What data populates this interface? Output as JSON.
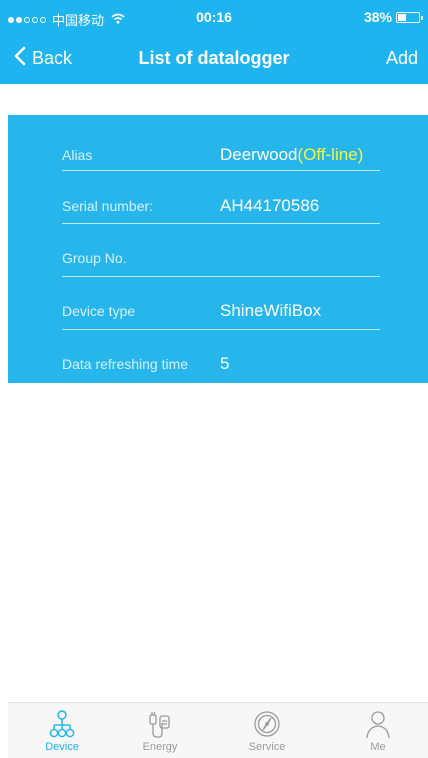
{
  "status_bar": {
    "carrier": "中国移动",
    "time": "00:16",
    "battery": "38%"
  },
  "nav": {
    "back_label": "Back",
    "title": "List of datalogger",
    "add_label": "Add"
  },
  "device": {
    "rows": [
      {
        "label": "Alias",
        "value": "Deerwood",
        "status": "(Off-line)"
      },
      {
        "label": "Serial number:",
        "value": "AH44170586"
      },
      {
        "label": "Group No.",
        "value": ""
      },
      {
        "label": "Device type",
        "value": "ShineWifiBox"
      },
      {
        "label": "Data refreshing time",
        "value": "5"
      }
    ]
  },
  "tabs": [
    {
      "label": "Device",
      "icon": "device-tree-icon",
      "active": true
    },
    {
      "label": "Energy",
      "icon": "energy-plug-icon",
      "active": false
    },
    {
      "label": "Service",
      "icon": "service-compass-icon",
      "active": false
    },
    {
      "label": "Me",
      "icon": "person-icon",
      "active": false
    }
  ],
  "colors": {
    "brand_blue": "#1eb4f0",
    "card_blue": "#27b6ec",
    "offline_yellow": "#f3f545",
    "tab_inactive": "#9a9a9a"
  }
}
